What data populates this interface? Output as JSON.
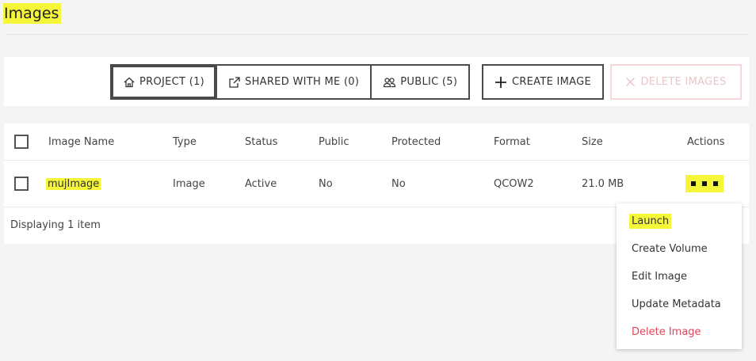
{
  "page": {
    "title": "Images"
  },
  "toolbar": {
    "filters": [
      {
        "label": "PROJECT (1)",
        "icon": "home-icon",
        "active": true
      },
      {
        "label": "SHARED WITH ME (0)",
        "icon": "external-link-icon",
        "active": false
      },
      {
        "label": "PUBLIC (5)",
        "icon": "users-icon",
        "active": false
      }
    ],
    "create_label": "CREATE IMAGE",
    "create_icon": "plus-icon",
    "delete_label": "DELETE IMAGES",
    "delete_icon": "close-icon",
    "delete_disabled": true
  },
  "table": {
    "columns": [
      "Image Name",
      "Type",
      "Status",
      "Public",
      "Protected",
      "Format",
      "Size",
      "Actions"
    ],
    "rows": [
      {
        "name": "mujImage",
        "type": "Image",
        "status": "Active",
        "public": "No",
        "protected": "No",
        "format": "QCOW2",
        "size": "21.0 MB",
        "actions_icon": "more-actions-icon"
      }
    ],
    "footer": "Displaying 1 item"
  },
  "actions_menu": {
    "items": [
      {
        "label": "Launch",
        "danger": false
      },
      {
        "label": "Create Volume",
        "danger": false
      },
      {
        "label": "Edit Image",
        "danger": false
      },
      {
        "label": "Update Metadata",
        "danger": false
      },
      {
        "label": "Delete Image",
        "danger": true
      }
    ]
  },
  "colors": {
    "highlight": "#f5f539",
    "danger": "#e0455a",
    "border": "#4a4a4a",
    "disabled": "#e8c7ca"
  }
}
